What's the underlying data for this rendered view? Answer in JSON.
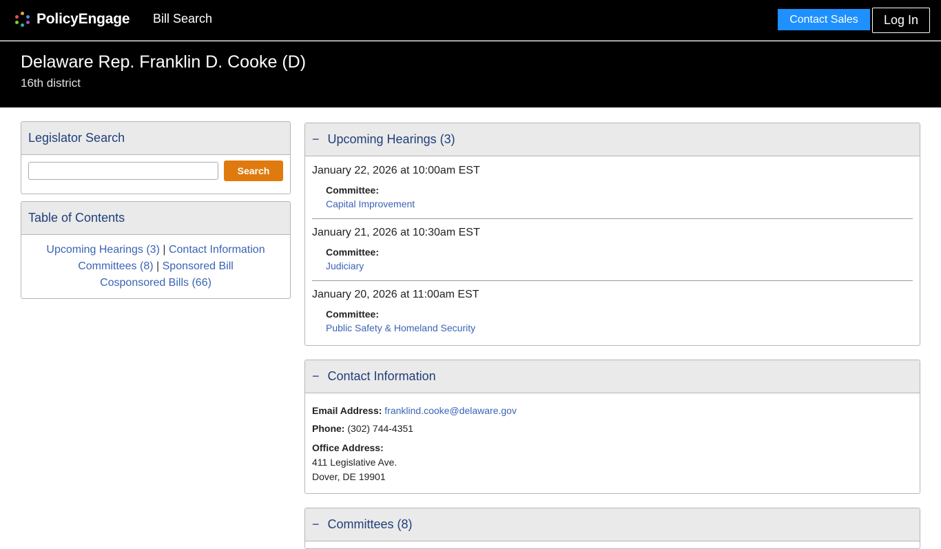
{
  "nav": {
    "brand": "PolicyEngage",
    "bill_search": "Bill Search",
    "contact_sales": "Contact Sales",
    "login": "Log In"
  },
  "header": {
    "title": "Delaware Rep. Franklin D. Cooke (D)",
    "subtitle": "16th district"
  },
  "legislator_search": {
    "title": "Legislator Search",
    "input_value": "",
    "button": "Search"
  },
  "toc": {
    "title": "Table of Contents",
    "links": {
      "hearings": "Upcoming Hearings (3)",
      "contact": "Contact Information",
      "committees": "Committees (8)",
      "sponsored": "Sponsored Bill",
      "cosponsored": "Cosponsored Bills (66)"
    },
    "separator": "|"
  },
  "hearings": {
    "toggle": "−",
    "title": "Upcoming Hearings (3)",
    "committee_label": "Committee:",
    "items": [
      {
        "date": "January 22, 2026 at 10:00am EST",
        "committee": "Capital Improvement"
      },
      {
        "date": "January 21, 2026 at 10:30am EST",
        "committee": "Judiciary"
      },
      {
        "date": "January 20, 2026 at 11:00am EST",
        "committee": "Public Safety & Homeland Security"
      }
    ]
  },
  "contact": {
    "toggle": "−",
    "title": "Contact Information",
    "email_label": "Email Address:",
    "email": "franklind.cooke@delaware.gov",
    "phone_label": "Phone:",
    "phone": "(302) 744-4351",
    "office_label": "Office Address:",
    "address_line1": "411 Legislative Ave.",
    "address_line2": "Dover, DE 19901"
  },
  "committees": {
    "toggle": "−",
    "title": "Committees (8)"
  },
  "colors": {
    "accent_blue": "#1e90ff",
    "search_orange": "#e07a0e",
    "link_blue": "#3a63b5",
    "heading_blue": "#1f3f7a"
  }
}
